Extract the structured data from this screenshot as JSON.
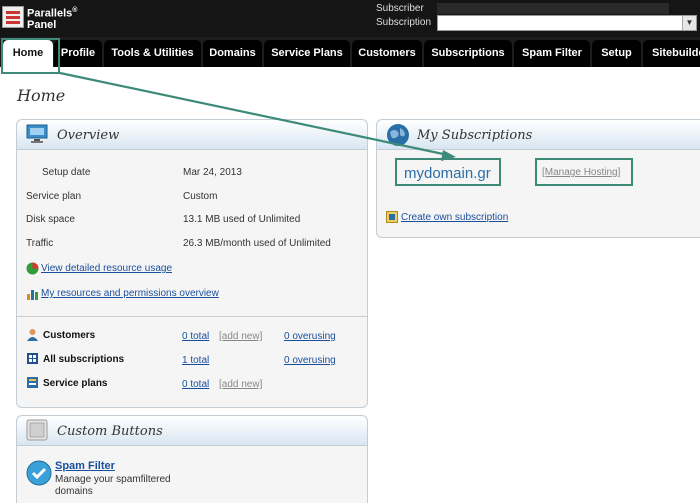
{
  "header": {
    "brand_line1": "Parallels",
    "brand_reg": "®",
    "brand_line2": "Panel",
    "subscriber_label": "Subscriber",
    "subscription_label": "Subscription"
  },
  "nav": {
    "tabs": [
      {
        "label": "Home",
        "active": true
      },
      {
        "label": "Profile"
      },
      {
        "label": "Tools & Utilities"
      },
      {
        "label": "Domains"
      },
      {
        "label": "Service Plans"
      },
      {
        "label": "Customers"
      },
      {
        "label": "Subscriptions"
      },
      {
        "label": "Spam Filter"
      },
      {
        "label": "Setup"
      },
      {
        "label": "Sitebuilde"
      }
    ]
  },
  "page": {
    "title": "Home"
  },
  "overview": {
    "title": "Overview",
    "rows": [
      {
        "label": "Setup date",
        "value": "Mar 24, 2013"
      },
      {
        "label": "Service plan",
        "value": "Custom"
      },
      {
        "label": "Disk space",
        "value": "13.1 MB used of Unlimited"
      },
      {
        "label": "Traffic",
        "value": "26.3 MB/month used of Unlimited"
      }
    ],
    "link_resources": "View detailed resource usage",
    "link_permissions": "My resources and permissions overview",
    "stats": [
      {
        "label": "Customers",
        "total": "0 total",
        "add": "[add new]",
        "over": "0 overusing"
      },
      {
        "label": "All subscriptions",
        "total": "1 total",
        "over": "0 overusing"
      },
      {
        "label": "Service plans",
        "total": "0 total",
        "add": "[add new]"
      }
    ]
  },
  "custom_buttons": {
    "title": "Custom Buttons",
    "spam_title": "Spam Filter",
    "spam_desc_1": "Manage your spamfiltered",
    "spam_desc_2": "domains"
  },
  "subscriptions": {
    "title": "My Subscriptions",
    "domain": "mydomain.gr",
    "manage": "[Manage Hosting]",
    "create": "Create own subscription"
  },
  "colors": {
    "annotation": "#3d8a78",
    "link": "#1a4f9c",
    "panel_head": "#d8e6f2"
  }
}
